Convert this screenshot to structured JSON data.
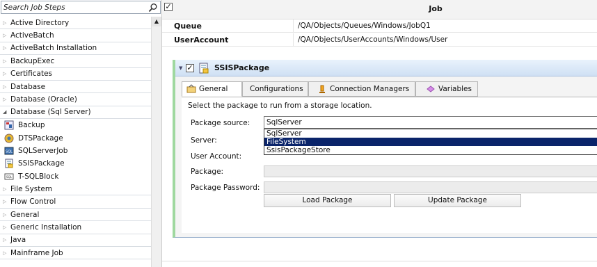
{
  "sidebar": {
    "search_placeholder": "Search Job Steps",
    "categories_top": [
      "Active Directory",
      "ActiveBatch",
      "ActiveBatch Installation",
      "BackupExec",
      "Certificates",
      "Database",
      "Database (Oracle)"
    ],
    "open_category": "Database (Sql Server)",
    "open_items": [
      "Backup",
      "DTSPackage",
      "SQLServerJob",
      "SSISPackage",
      "T-SQLBlock"
    ],
    "categories_bottom": [
      "File System",
      "Flow Control",
      "General",
      "Generic Installation",
      "Java",
      "Mainframe Job"
    ]
  },
  "job": {
    "header": "Job",
    "properties": [
      {
        "name": "Queue",
        "value": "/QA/Objects/Queues/Windows/JobQ1"
      },
      {
        "name": "UserAccount",
        "value": "/QA/Objects/UserAccounts/Windows/User"
      }
    ]
  },
  "step": {
    "title": "SSISPackage",
    "tabs": [
      "General",
      "Configurations",
      "Connection Managers",
      "Variables"
    ],
    "active_tab": "General",
    "instruction": "Select the package to run from a storage location.",
    "fields": {
      "package_source_label": "Package source:",
      "package_source_value": "SqlServer",
      "server_label": "Server:",
      "user_account_label": "User Account:",
      "package_label": "Package:",
      "package_password_label": "Package Password:"
    },
    "dropdown_options": [
      "SqlServer",
      "FileSystem",
      "SsisPackageStore"
    ],
    "dropdown_selected": "FileSystem",
    "buttons": {
      "load": "Load Package",
      "update": "Update Package"
    }
  },
  "colors": {
    "selection": "#0a246a",
    "accent_green": "#9fd89f",
    "title_bar_blue": "#cfe0f4"
  }
}
